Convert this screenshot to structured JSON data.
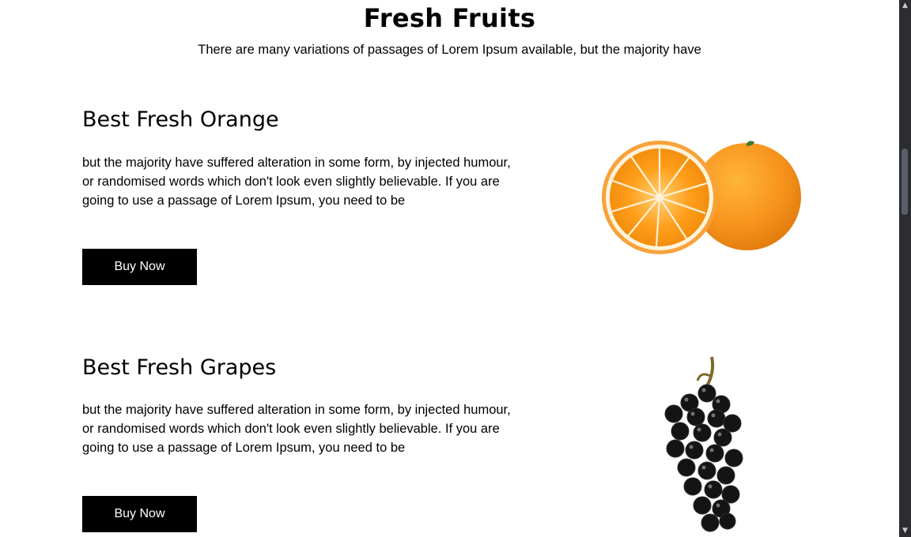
{
  "section": {
    "title": "Fresh Fruits",
    "subtitle": "There are many variations of passages of Lorem Ipsum available, but the majority have"
  },
  "products": [
    {
      "title": "Best Fresh Orange",
      "description_lines": [
        "but the majority have suffered alteration in some form, by injected humour,",
        "or randomised words which don't look even slightly believable. If you are",
        "going to use a passage of Lorem Ipsum, you need to be"
      ],
      "button_label": "Buy Now",
      "image_icon": "orange-image"
    },
    {
      "title": "Best Fresh Grapes",
      "description_lines": [
        "but the majority have suffered alteration in some form, by injected humour,",
        "or randomised words which don't look even slightly believable. If you are",
        "going to use a passage of Lorem Ipsum, you need to be"
      ],
      "button_label": "Buy Now",
      "image_icon": "grapes-image"
    }
  ],
  "colors": {
    "button_bg": "#000000",
    "button_text": "#ffffff",
    "orange": "#f7941d",
    "grape": "#141414",
    "scrollbar_track": "#2b2d33",
    "scrollbar_thumb": "#5b5e66"
  },
  "scrollbar": {
    "up_icon": "chevron-up-icon",
    "down_icon": "chevron-down-icon"
  }
}
